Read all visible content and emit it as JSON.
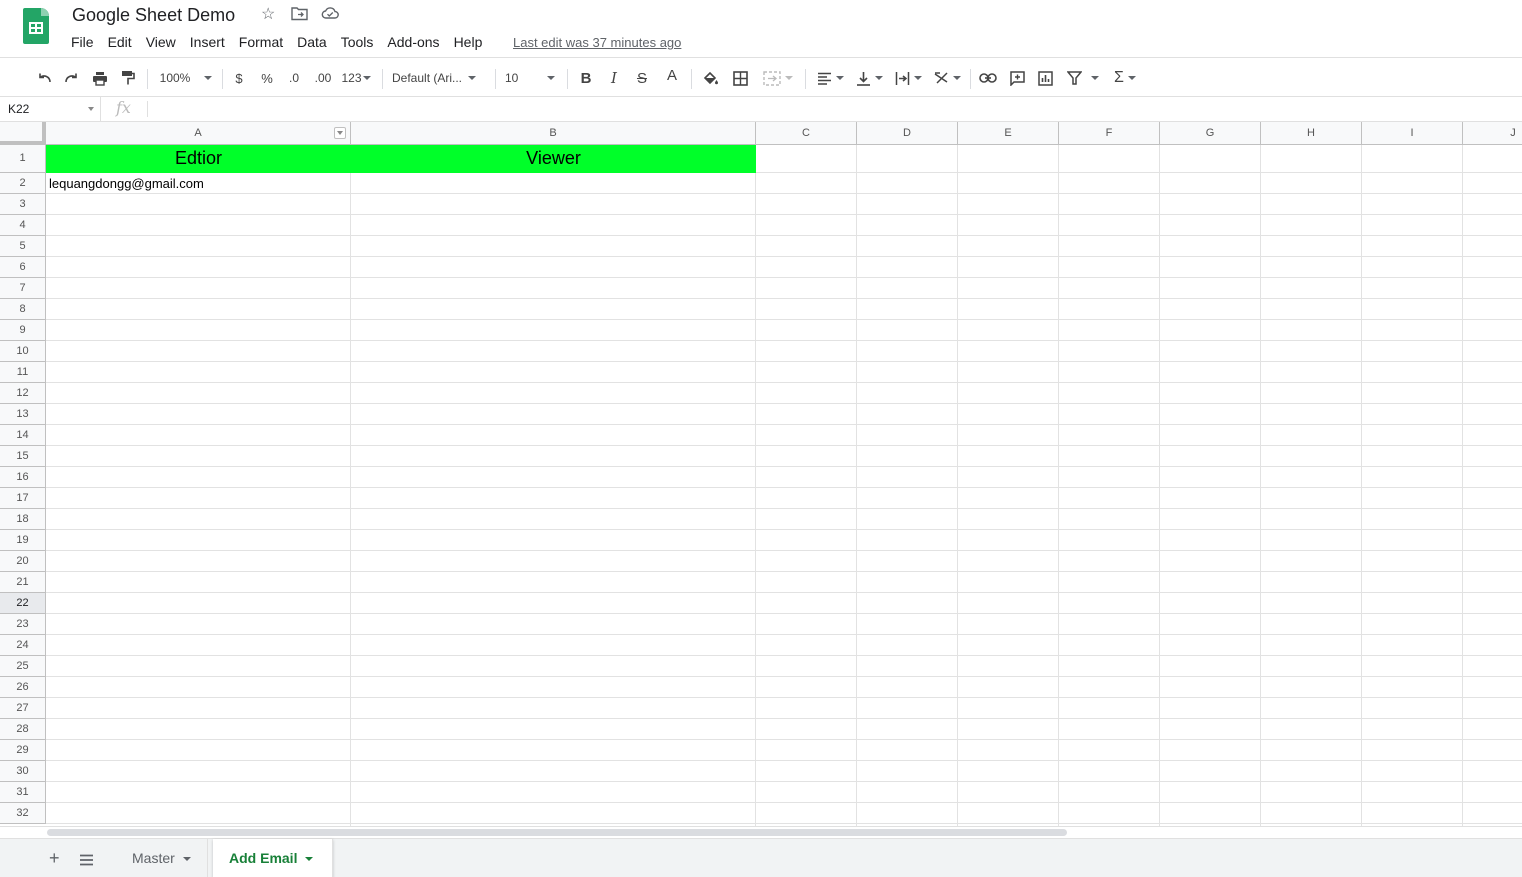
{
  "app": {
    "title": "Google Sheet Demo",
    "last_edit": "Last edit was 37 minutes ago",
    "brand_color": "#23a566"
  },
  "menu": [
    "File",
    "Edit",
    "View",
    "Insert",
    "Format",
    "Data",
    "Tools",
    "Add-ons",
    "Help"
  ],
  "toolbar": {
    "zoom": "100%",
    "currency": "$",
    "percent": "%",
    "decimal_decrease": ".0",
    "decimal_increase": ".00",
    "more_formats": "123",
    "font": "Default (Ari...",
    "font_size": "10"
  },
  "formula_bar": {
    "cell_ref": "K22",
    "fx_label": "fx",
    "formula": ""
  },
  "grid": {
    "columns": [
      "A",
      "B",
      "C",
      "D",
      "E",
      "F",
      "G",
      "H",
      "I",
      "J"
    ],
    "rows": [
      "1",
      "2",
      "3",
      "4",
      "5",
      "6",
      "7",
      "8",
      "9",
      "10",
      "11",
      "12",
      "13",
      "14",
      "15",
      "16",
      "17",
      "18",
      "19",
      "20",
      "21",
      "22",
      "23",
      "24",
      "25",
      "26",
      "27",
      "28",
      "29",
      "30",
      "31",
      "32"
    ],
    "active_row": "22",
    "header_fill": "#00ff29",
    "cells": {
      "A1": "Edtior",
      "B1": "Viewer",
      "A2": "lequangdongg@gmail.com"
    }
  },
  "sheets": {
    "tabs": [
      "Master",
      "Add Email"
    ],
    "active": "Add Email"
  }
}
